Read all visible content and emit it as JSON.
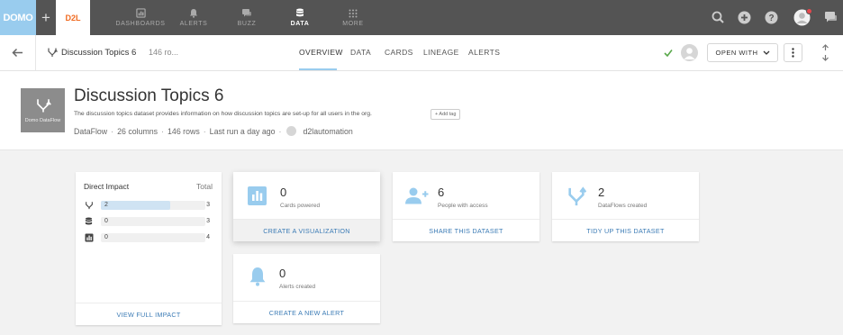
{
  "brand": {
    "logo_text": "DOMO",
    "customer_logo_text": "D2L",
    "accent_color": "#99ccee",
    "link_color": "#3b7bb5"
  },
  "topnav": {
    "items": [
      {
        "label": "DASHBOARDS",
        "icon": "dashboard-icon"
      },
      {
        "label": "ALERTS",
        "icon": "bell-icon"
      },
      {
        "label": "BUZZ",
        "icon": "chat-icon"
      },
      {
        "label": "DATA",
        "icon": "database-icon",
        "active": true
      },
      {
        "label": "MORE",
        "icon": "grid-icon"
      }
    ],
    "right_icons": [
      "search-icon",
      "add-icon",
      "help-icon",
      "user-avatar-icon",
      "chat-icon"
    ]
  },
  "subbar": {
    "dataset_name": "Discussion Topics 6",
    "rows_preview": "146 ro...",
    "tabs": [
      "OVERVIEW",
      "DATA",
      "CARDS",
      "LINEAGE",
      "ALERTS"
    ],
    "active_tab": "OVERVIEW",
    "open_with_label": "OPEN WITH"
  },
  "dataset": {
    "title": "Discussion Topics 6",
    "thumb_label": "Domo DataFlow",
    "description": "The discussion topics dataset provides information on how discussion topics are set-up for all users in the org.",
    "add_tag_label": "+ Add tag",
    "meta": {
      "type": "DataFlow",
      "columns": "26 columns",
      "rows": "146 rows",
      "last_run": "Last run a day ago",
      "owner": "d2lautomation"
    }
  },
  "impact": {
    "title": "Direct Impact",
    "total_label": "Total",
    "rows": [
      {
        "icon": "dataflow-icon",
        "value": "2",
        "total": "3",
        "fill_fraction": 0.667
      },
      {
        "icon": "database-icon",
        "value": "0",
        "total": "3",
        "fill_fraction": 0
      },
      {
        "icon": "card-chart-icon",
        "value": "0",
        "total": "4",
        "fill_fraction": 0
      }
    ],
    "footer_label": "VIEW FULL IMPACT"
  },
  "cards": {
    "powered": {
      "number": "0",
      "label": "Cards powered",
      "action": "CREATE A VISUALIZATION"
    },
    "access": {
      "number": "6",
      "label": "People with access",
      "action": "SHARE THIS DATASET"
    },
    "dataflows": {
      "number": "2",
      "label": "DataFlows created",
      "action": "TIDY UP THIS DATASET"
    },
    "alerts": {
      "number": "0",
      "label": "Alerts created",
      "action": "CREATE A NEW ALERT"
    }
  }
}
